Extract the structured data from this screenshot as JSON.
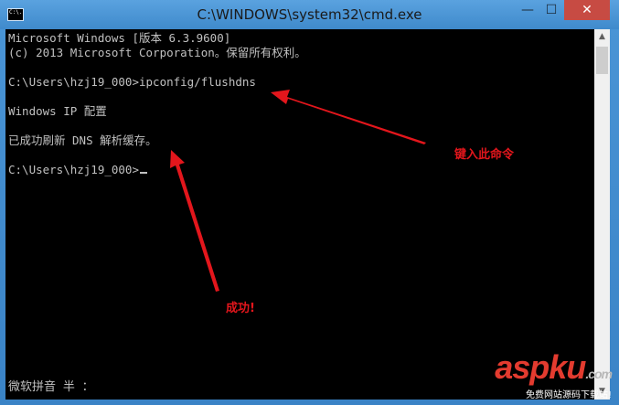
{
  "window": {
    "title": "C:\\WINDOWS\\system32\\cmd.exe",
    "icon_label": "C:\\.",
    "minimize_glyph": "—",
    "maximize_glyph": "☐",
    "close_glyph": "✕"
  },
  "console": {
    "lines": [
      "Microsoft Windows [版本 6.3.9600]",
      "(c) 2013 Microsoft Corporation。保留所有权利。",
      "",
      "C:\\Users\\hzj19_000>ipconfig/flushdns",
      "",
      "Windows IP 配置",
      "",
      "已成功刷新 DNS 解析缓存。",
      "",
      "C:\\Users\\hzj19_000>"
    ],
    "ime_status": "微软拼音 半 ："
  },
  "annotations": {
    "enter_command": "键入此命令",
    "success": "成功!"
  },
  "watermark": {
    "logo_asp": "asp",
    "logo_ku": "ku",
    "logo_com": ".com",
    "tagline": "免费网站源码下载站!"
  },
  "colors": {
    "console_bg": "#000000",
    "console_text": "#c0c0c0",
    "annotation_red": "#e3161c",
    "title_bar": "#4a95d6",
    "close_button": "#c74b43"
  },
  "icons": [
    "cmd-app-icon",
    "minimize-icon",
    "maximize-icon",
    "close-icon",
    "scroll-up-icon",
    "scroll-down-icon"
  ]
}
